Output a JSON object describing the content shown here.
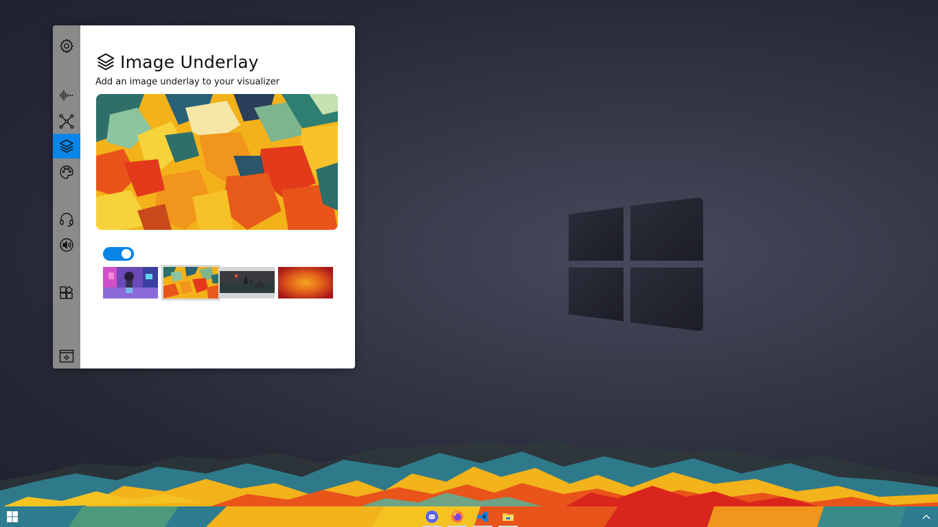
{
  "window": {
    "title": "Image Underlay",
    "subtitle": "Add an image underlay to your visualizer",
    "toggle_on": true,
    "accent_color": "#0a84e6",
    "rail_color": "#8a8a8a"
  },
  "sidebar": {
    "items": [
      {
        "icon": "gear-icon",
        "active": false
      },
      {
        "icon": "waveform-icon",
        "active": false
      },
      {
        "icon": "network-nodes-icon",
        "active": false
      },
      {
        "icon": "layers-icon",
        "active": true
      },
      {
        "icon": "palette-icon",
        "active": false
      },
      {
        "icon": "headset-icon",
        "active": false
      },
      {
        "icon": "speaker-icon",
        "active": false
      },
      {
        "icon": "widgets-icon",
        "active": false
      },
      {
        "icon": "window-settings-icon",
        "active": false
      }
    ]
  },
  "thumbnails": [
    {
      "name": "anime-girl-thumbnail",
      "selected": false
    },
    {
      "name": "abstract-waves-thumbnail",
      "selected": true
    },
    {
      "name": "dark-landscape-thumbnail",
      "selected": false
    },
    {
      "name": "orange-sun-thumbnail",
      "selected": false
    }
  ],
  "taskbar": {
    "apps": [
      {
        "icon": "discord-icon"
      },
      {
        "icon": "firefox-icon"
      },
      {
        "icon": "vscode-icon"
      },
      {
        "icon": "file-explorer-icon"
      }
    ]
  }
}
